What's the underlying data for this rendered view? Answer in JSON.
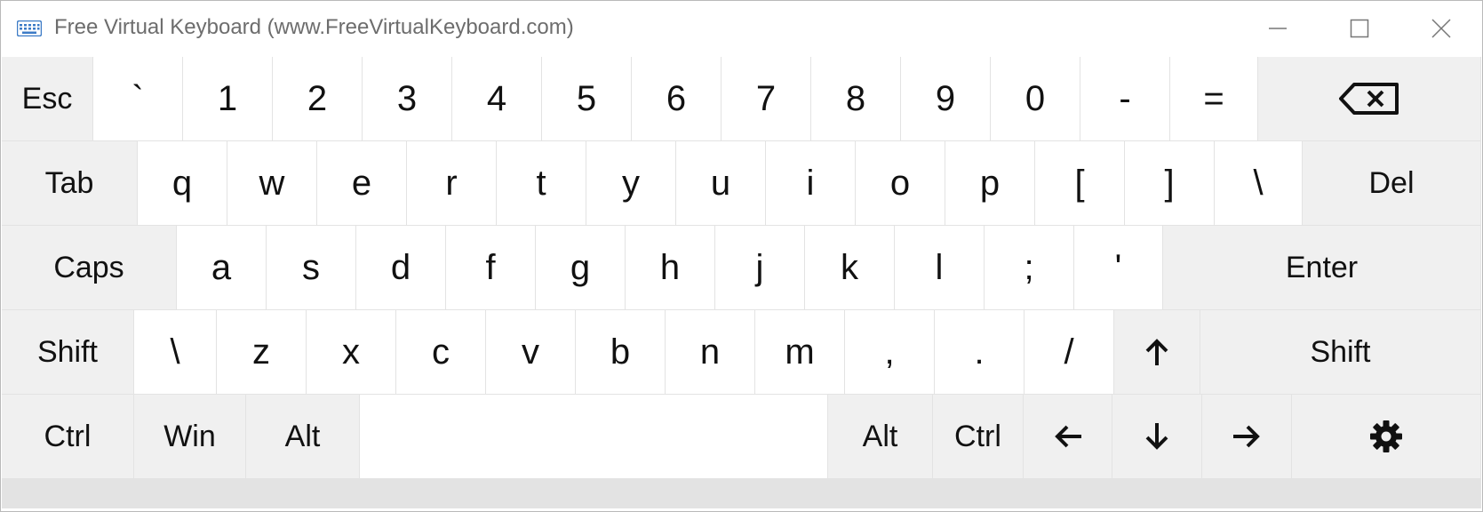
{
  "window": {
    "title": "Free Virtual Keyboard (www.FreeVirtualKeyboard.com)",
    "icon": "keyboard-icon",
    "controls": [
      "minimize-icon",
      "maximize-icon",
      "close-icon"
    ]
  },
  "keyboard": {
    "rows": [
      [
        {
          "label": "Esc",
          "style": "gray"
        },
        {
          "label": "`"
        },
        {
          "label": "1"
        },
        {
          "label": "2"
        },
        {
          "label": "3"
        },
        {
          "label": "4"
        },
        {
          "label": "5"
        },
        {
          "label": "6"
        },
        {
          "label": "7"
        },
        {
          "label": "8"
        },
        {
          "label": "9"
        },
        {
          "label": "0"
        },
        {
          "label": "-"
        },
        {
          "label": "="
        },
        {
          "label": "",
          "icon": "backspace-icon",
          "style": "gray"
        }
      ],
      [
        {
          "label": "Tab",
          "style": "gray"
        },
        {
          "label": "q"
        },
        {
          "label": "w"
        },
        {
          "label": "e"
        },
        {
          "label": "r"
        },
        {
          "label": "t"
        },
        {
          "label": "y"
        },
        {
          "label": "u"
        },
        {
          "label": "i"
        },
        {
          "label": "o"
        },
        {
          "label": "p"
        },
        {
          "label": "["
        },
        {
          "label": "]"
        },
        {
          "label": "\\"
        },
        {
          "label": "Del",
          "style": "gray"
        }
      ],
      [
        {
          "label": "Caps",
          "style": "gray"
        },
        {
          "label": "a"
        },
        {
          "label": "s"
        },
        {
          "label": "d"
        },
        {
          "label": "f"
        },
        {
          "label": "g"
        },
        {
          "label": "h"
        },
        {
          "label": "j"
        },
        {
          "label": "k"
        },
        {
          "label": "l"
        },
        {
          "label": ";"
        },
        {
          "label": "'"
        },
        {
          "label": "Enter",
          "style": "gray"
        }
      ],
      [
        {
          "label": "Shift",
          "style": "gray"
        },
        {
          "label": "\\"
        },
        {
          "label": "z"
        },
        {
          "label": "x"
        },
        {
          "label": "c"
        },
        {
          "label": "v"
        },
        {
          "label": "b"
        },
        {
          "label": "n"
        },
        {
          "label": "m"
        },
        {
          "label": ","
        },
        {
          "label": "."
        },
        {
          "label": "/"
        },
        {
          "label": "",
          "icon": "arrow-up-icon",
          "style": "gray"
        },
        {
          "label": "Shift",
          "style": "gray"
        }
      ],
      [
        {
          "label": "Ctrl",
          "style": "gray"
        },
        {
          "label": "Win",
          "style": "gray"
        },
        {
          "label": "Alt",
          "style": "gray"
        },
        {
          "label": "",
          "name": "space"
        },
        {
          "label": "Alt",
          "style": "gray"
        },
        {
          "label": "Ctrl",
          "style": "gray"
        },
        {
          "label": "",
          "icon": "arrow-left-icon",
          "style": "gray"
        },
        {
          "label": "",
          "icon": "arrow-down-icon",
          "style": "gray"
        },
        {
          "label": "",
          "icon": "arrow-right-icon",
          "style": "gray"
        },
        {
          "label": "",
          "icon": "gear-icon",
          "style": "gray"
        }
      ]
    ]
  }
}
